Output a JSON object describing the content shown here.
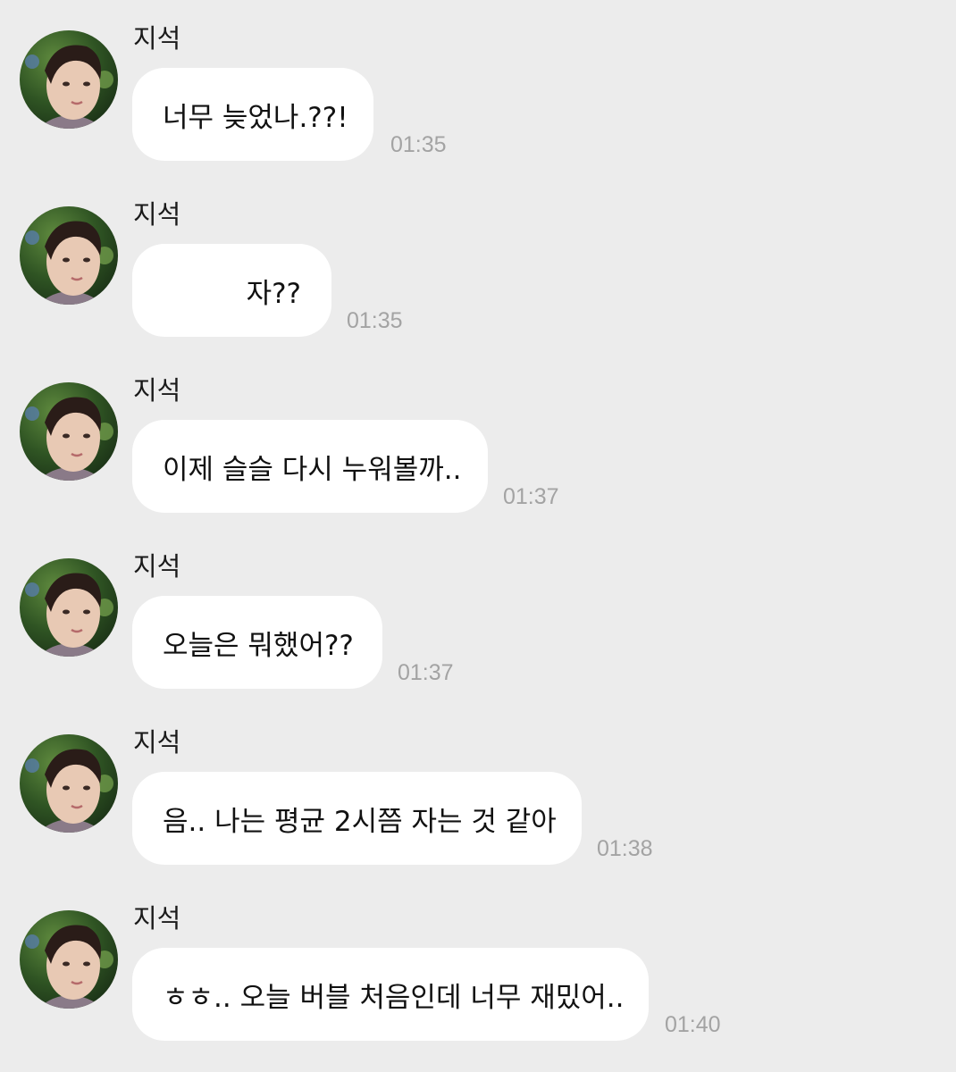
{
  "chat": {
    "messages": [
      {
        "sender": "지석",
        "text": "너무 늦었나.??!",
        "time": "01:35"
      },
      {
        "sender": "지석",
        "text": "자??",
        "time": "01:35"
      },
      {
        "sender": "지석",
        "text": "이제 슬슬 다시 누워볼까..",
        "time": "01:37"
      },
      {
        "sender": "지석",
        "text": "오늘은 뭐했어??",
        "time": "01:37"
      },
      {
        "sender": "지석",
        "text": "음.. 나는 평균 2시쯤 자는 것 같아",
        "time": "01:38"
      },
      {
        "sender": "지석",
        "text": "ㅎㅎ.. 오늘 버블 처음인데 너무 재밌어..",
        "time": "01:40"
      }
    ]
  },
  "colors": {
    "background": "#ececec",
    "bubble": "#ffffff",
    "timestamp": "#a3a3a3",
    "text": "#111111"
  },
  "icons": {
    "avatar": "profile-photo-avatar"
  }
}
